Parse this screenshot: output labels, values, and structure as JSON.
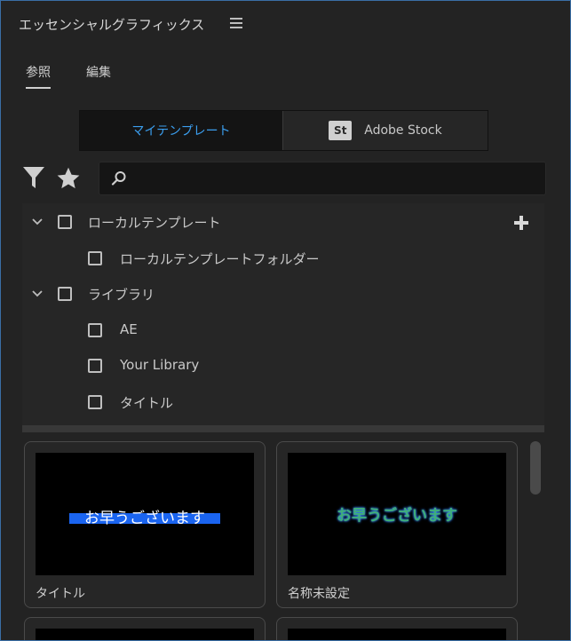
{
  "panel": {
    "title": "エッセンシャルグラフィックス"
  },
  "tabs": [
    {
      "label": "参照",
      "active": true
    },
    {
      "label": "編集",
      "active": false
    }
  ],
  "source_toggle": {
    "my_templates": "マイテンプレート",
    "adobe_stock_badge": "St",
    "adobe_stock": "Adobe Stock",
    "selected": "マイテンプレート"
  },
  "search": {
    "placeholder": "",
    "value": ""
  },
  "tree": {
    "local_templates": {
      "label": "ローカルテンプレート",
      "expanded": true,
      "checked": false
    },
    "local_template_folder": {
      "label": "ローカルテンプレートフォルダー",
      "checked": false
    },
    "libraries": {
      "label": "ライブラリ",
      "expanded": true,
      "checked": false
    },
    "library_items": [
      {
        "label": "AE",
        "checked": false
      },
      {
        "label": "Your Library",
        "checked": false
      },
      {
        "label": "タイトル",
        "checked": false
      }
    ]
  },
  "templates": [
    {
      "thumbnail_text": "お早うございます",
      "label": "タイトル"
    },
    {
      "thumbnail_text": "お早うございます",
      "label": "名称未設定"
    }
  ],
  "colors": {
    "accent": "#3b9eee",
    "highlight_bar": "#1a64f0",
    "thumb_text_green": "#3fae7a"
  }
}
